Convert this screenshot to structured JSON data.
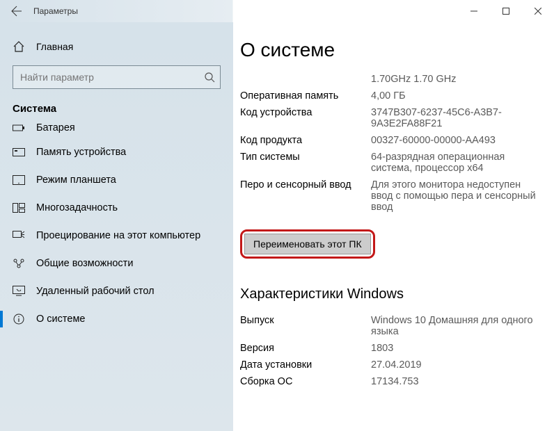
{
  "window": {
    "title": "Параметры"
  },
  "sidebar": {
    "home": "Главная",
    "search_placeholder": "Найти параметр",
    "section": "Система",
    "items": [
      {
        "label": "Батарея"
      },
      {
        "label": "Память устройства"
      },
      {
        "label": "Режим планшета"
      },
      {
        "label": "Многозадачность"
      },
      {
        "label": "Проецирование на этот компьютер"
      },
      {
        "label": "Общие возможности"
      },
      {
        "label": "Удаленный рабочий стол"
      },
      {
        "label": "О системе"
      }
    ]
  },
  "main": {
    "title": "О системе",
    "specs": [
      {
        "label": "",
        "value": "1.70GHz   1.70 GHz"
      },
      {
        "label": "Оперативная память",
        "value": "4,00 ГБ"
      },
      {
        "label": "Код устройства",
        "value": "3747B307-6237-45C6-A3B7-9A3E2FA88F21"
      },
      {
        "label": "Код продукта",
        "value": "00327-60000-00000-AA493"
      },
      {
        "label": "Тип системы",
        "value": "64-разрядная операционная система, процессор x64"
      },
      {
        "label": "Перо и сенсорный ввод",
        "value": "Для этого монитора недоступен ввод с помощью пера и сенсорный ввод"
      }
    ],
    "rename_button": "Переименовать этот ПК",
    "windows_heading": "Характеристики Windows",
    "windows_specs": [
      {
        "label": "Выпуск",
        "value": "Windows 10 Домашняя для одного языка"
      },
      {
        "label": "Версия",
        "value": "1803"
      },
      {
        "label": "Дата установки",
        "value": "27.04.2019"
      },
      {
        "label": "Сборка ОС",
        "value": "17134.753"
      }
    ]
  }
}
